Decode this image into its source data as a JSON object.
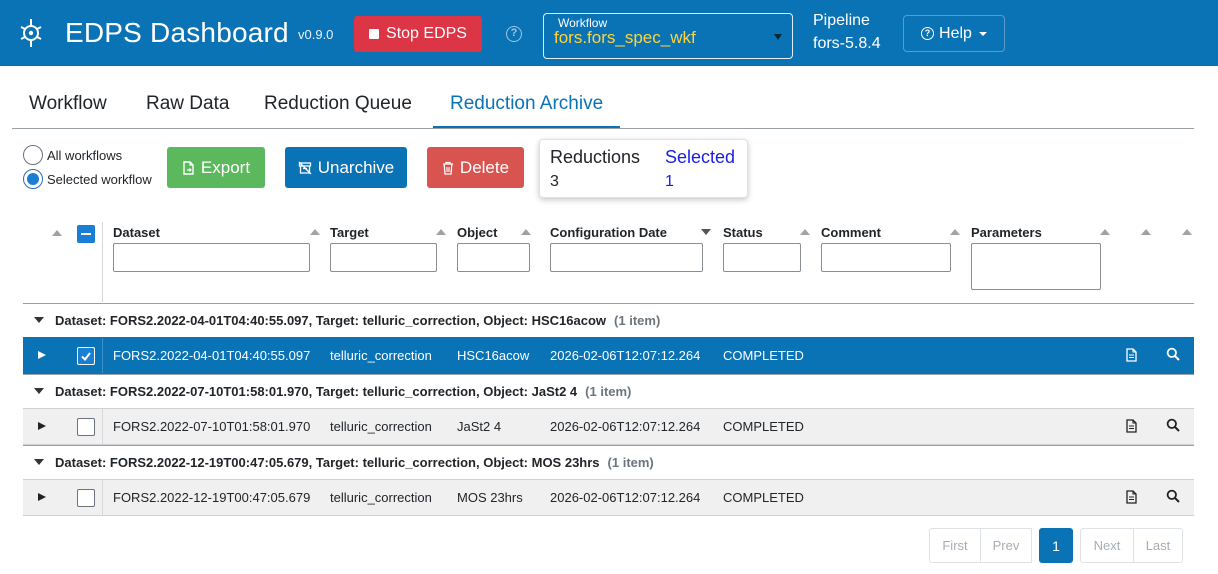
{
  "navbar": {
    "brand": "EDPS Dashboard",
    "version": "v0.9.0",
    "stop_label": "Stop EDPS",
    "workflow_label": "Workflow",
    "workflow_value": "fors.fors_spec_wkf",
    "pipeline_label": "Pipeline",
    "pipeline_value": "fors-5.8.4",
    "help_label": "Help",
    "colors": {
      "bar": "#0a73b6",
      "workflow_value": "#ffd43b",
      "stop": "#dc3545"
    }
  },
  "tabs": [
    {
      "label": "Workflow",
      "active": false
    },
    {
      "label": "Raw Data",
      "active": false
    },
    {
      "label": "Reduction Queue",
      "active": false
    },
    {
      "label": "Reduction Archive",
      "active": true
    }
  ],
  "toolbar": {
    "radio_all": "All workflows",
    "radio_selected": "Selected workflow",
    "selected_radio": "Selected workflow",
    "export_label": "Export",
    "unarchive_label": "Unarchive",
    "delete_label": "Delete",
    "counter": {
      "reductions_label": "Reductions",
      "reductions_value": "3",
      "selected_label": "Selected",
      "selected_value": "1"
    }
  },
  "table": {
    "columns": {
      "dataset": "Dataset",
      "target": "Target",
      "object": "Object",
      "config_date": "Configuration Date",
      "status": "Status",
      "comment": "Comment",
      "parameters": "Parameters"
    },
    "groups": [
      {
        "title": "Dataset: FORS2.2022-04-01T04:40:55.097, Target: telluric_correction, Object: HSC16acow",
        "count": "(1 item)",
        "row": {
          "dataset": "FORS2.2022-04-01T04:40:55.097",
          "target": "telluric_correction",
          "object": "HSC16acow",
          "config_date": "2026-02-06T12:07:12.264",
          "status": "COMPLETED",
          "selected": true
        }
      },
      {
        "title": "Dataset: FORS2.2022-07-10T01:58:01.970, Target: telluric_correction, Object: JaSt2 4",
        "count": "(1 item)",
        "row": {
          "dataset": "FORS2.2022-07-10T01:58:01.970",
          "target": "telluric_correction",
          "object": "JaSt2 4",
          "config_date": "2026-02-06T12:07:12.264",
          "status": "COMPLETED",
          "selected": false
        }
      },
      {
        "title": "Dataset: FORS2.2022-12-19T00:47:05.679, Target: telluric_correction, Object: MOS 23hrs",
        "count": "(1 item)",
        "row": {
          "dataset": "FORS2.2022-12-19T00:47:05.679",
          "target": "telluric_correction",
          "object": "MOS 23hrs",
          "config_date": "2026-02-06T12:07:12.264",
          "status": "COMPLETED",
          "selected": false
        }
      }
    ]
  },
  "pagination": {
    "first": "First",
    "prev": "Prev",
    "current": "1",
    "next": "Next",
    "last": "Last"
  }
}
